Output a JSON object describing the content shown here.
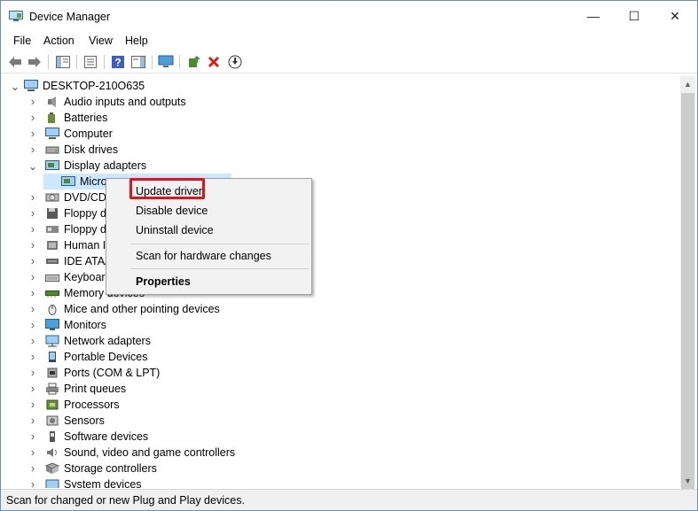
{
  "window": {
    "title": "Device Manager",
    "minimize": "—",
    "maximize": "☐",
    "close": "✕"
  },
  "menubar": {
    "items": [
      "File",
      "Action",
      "View",
      "Help"
    ]
  },
  "toolbar": {
    "buttons": [
      "back-icon",
      "forward-icon",
      "show-hide-console-tree-icon",
      "properties-icon",
      "help-icon",
      "action-pane-icon",
      "monitor-icon",
      "update-driver-icon",
      "uninstall-icon",
      "download-icon"
    ]
  },
  "tree": {
    "root": "DESKTOP-210O635",
    "items": [
      {
        "label": "Audio inputs and outputs",
        "icon": "speaker-icon"
      },
      {
        "label": "Batteries",
        "icon": "battery-icon"
      },
      {
        "label": "Computer",
        "icon": "computer-icon"
      },
      {
        "label": "Disk drives",
        "icon": "disk-drive-icon"
      },
      {
        "label": "Display adapters",
        "icon": "display-adapter-icon",
        "expanded": true
      },
      {
        "label": "Micro",
        "icon": "display-adapter-icon",
        "child": true,
        "selected": true
      },
      {
        "label": "DVD/CD-",
        "icon": "dvd-drive-icon"
      },
      {
        "label": "Floppy di",
        "icon": "floppy-icon"
      },
      {
        "label": "Floppy dr",
        "icon": "floppy-controller-icon"
      },
      {
        "label": "Human In",
        "icon": "hid-icon"
      },
      {
        "label": "IDE ATA/",
        "icon": "ide-icon"
      },
      {
        "label": "Keyboard",
        "icon": "keyboard-icon"
      },
      {
        "label": "Memory devices",
        "icon": "memory-icon"
      },
      {
        "label": "Mice and other pointing devices",
        "icon": "mouse-icon"
      },
      {
        "label": "Monitors",
        "icon": "monitor-icon"
      },
      {
        "label": "Network adapters",
        "icon": "network-icon"
      },
      {
        "label": "Portable Devices",
        "icon": "portable-device-icon"
      },
      {
        "label": "Ports (COM & LPT)",
        "icon": "port-icon"
      },
      {
        "label": "Print queues",
        "icon": "printer-icon"
      },
      {
        "label": "Processors",
        "icon": "processor-icon"
      },
      {
        "label": "Sensors",
        "icon": "sensor-icon"
      },
      {
        "label": "Software devices",
        "icon": "software-device-icon"
      },
      {
        "label": "Sound, video and game controllers",
        "icon": "sound-icon"
      },
      {
        "label": "Storage controllers",
        "icon": "storage-icon"
      },
      {
        "label": "System devices",
        "icon": "system-icon"
      }
    ]
  },
  "context_menu": {
    "update_driver": "Update driver",
    "disable_device": "Disable device",
    "uninstall_device": "Uninstall device",
    "scan": "Scan for hardware changes",
    "properties": "Properties",
    "highlight_color": "#e8101a"
  },
  "status": {
    "text": "Scan for changed or new Plug and Play devices."
  }
}
